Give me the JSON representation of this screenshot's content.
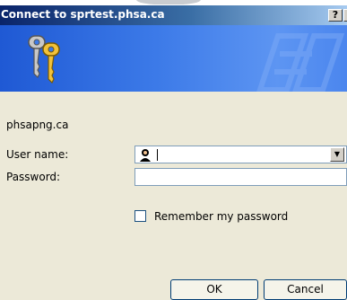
{
  "window": {
    "title": "Connect to sprtest.phsa.ca",
    "help_button": "?",
    "close_button": "✕"
  },
  "banner": {
    "icon": "keys-icon",
    "watermark": "server-icon"
  },
  "dialog": {
    "site": "phsapng.ca",
    "username_label": "User name:",
    "username_value": "",
    "password_label": "Password:",
    "password_value": "",
    "remember_label": "Remember my password",
    "remember_checked": false,
    "ok_label": "OK",
    "cancel_label": "Cancel"
  },
  "colors": {
    "title_bar_start": "#0a246a",
    "title_bar_end": "#a6caf0",
    "banner": "#3c7ae8",
    "dialog_bg": "#ece9d8"
  }
}
